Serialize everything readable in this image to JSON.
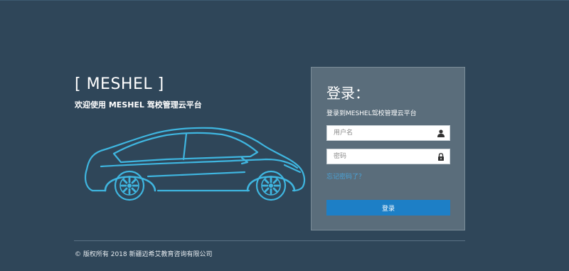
{
  "brand": {
    "title": "[ MESHEL ]",
    "subtitle": "欢迎使用 MESHEL 驾校管理云平台"
  },
  "illustration": {
    "icon": "car-icon",
    "color": "#3fb6e0"
  },
  "login": {
    "title": "登录：",
    "subtitle": "登录到MESHEL驾校管理云平台",
    "username": {
      "placeholder": "用户名",
      "value": "",
      "icon": "user-icon"
    },
    "password": {
      "placeholder": "密码",
      "value": "",
      "icon": "lock-icon"
    },
    "forgot_label": "忘记密码了？",
    "submit_label": "登录"
  },
  "footer": {
    "copyright": "© 版权所有 2018 新疆迈希艾教育咨询有限公司"
  },
  "colors": {
    "background": "#2f4659",
    "panel": "#5a6d7b",
    "accent": "#1d7fc6",
    "link": "#4aa3d8"
  }
}
